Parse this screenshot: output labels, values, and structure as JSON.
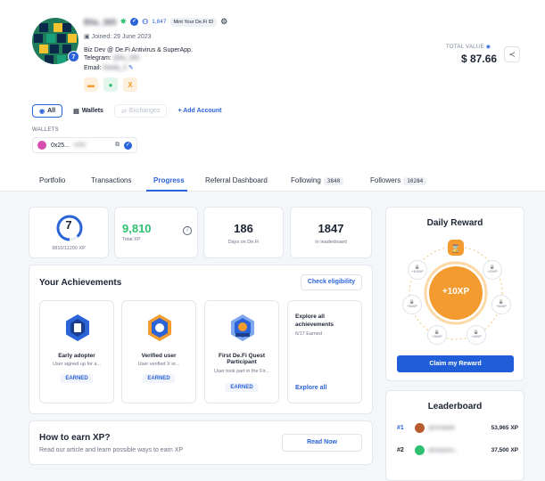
{
  "profile": {
    "username": "Blla_365",
    "follow_count": "1,847",
    "mint_label": "Mint Your De.Fi ID",
    "level": "7",
    "joined": "Joined: 29 June 2023",
    "bio": "Biz Dev @ De.Fi Antivirus & SuperApp.",
    "telegram_label": "Telegram:",
    "telegram_value": "@lla_365",
    "email_label": "Email:",
    "email_value": "hbella_3",
    "total_value_label": "TOTAL VALUE",
    "total_value": "$ 87.66"
  },
  "filters": {
    "all": "All",
    "wallets": "Wallets",
    "exchanges": "Exchanges",
    "add_account": "+ Add Account"
  },
  "wallets": {
    "label": "WALLETS",
    "address": "0x25...",
    "address_hidden": "a1b2"
  },
  "tabs": [
    {
      "label": "Portfolio"
    },
    {
      "label": "Transactions"
    },
    {
      "label": "Progress"
    },
    {
      "label": "Referral Dashboard"
    },
    {
      "label": "Following",
      "count": "3840"
    },
    {
      "label": "Followers",
      "count": "10284"
    }
  ],
  "stats": {
    "level": "7",
    "level_progress": "9810/11200 XP",
    "level_progress_fraction": 0.876,
    "total_xp": "9,810",
    "total_xp_label": "Total XP",
    "days": "186",
    "days_label": "Days on De.Fi",
    "rank": "1847",
    "rank_label": "In leaderboard"
  },
  "achievements": {
    "title": "Your Achievements",
    "check_button": "Check eligibility",
    "items": [
      {
        "name": "Early adopter",
        "desc": "User signed up for a...",
        "status": "EARNED"
      },
      {
        "name": "Verified user",
        "desc": "User verified X or...",
        "status": "EARNED"
      },
      {
        "name": "First De.Fi Quest Participant",
        "desc": "User took part in the Fir...",
        "status": "EARNED"
      }
    ],
    "explore_title": "Explore all achievements",
    "explore_count": "6/17 Earned",
    "explore_link": "Explore all"
  },
  "earn_xp": {
    "title": "How to earn XP?",
    "desc": "Read our article and learn possible ways to earn XP",
    "button": "Read Now"
  },
  "daily_reward": {
    "title": "Daily Reward",
    "center": "+10XP",
    "nodes": [
      "+100XP",
      "+20XP",
      "+50XP",
      "+50XP",
      "+30XP",
      "+40XP",
      "+60XP"
    ],
    "button": "Claim my Reward"
  },
  "leaderboard": {
    "title": "Leaderboard",
    "rows": [
      {
        "rank": "#1",
        "name": "@mrrebeth",
        "xp": "53,965 XP"
      },
      {
        "rank": "#2",
        "name": "@eurpassi...",
        "xp": "37,500 XP"
      }
    ]
  },
  "colors": {
    "accent": "#2b63d9",
    "orange": "#f39b2e",
    "green": "#2fbf71"
  }
}
